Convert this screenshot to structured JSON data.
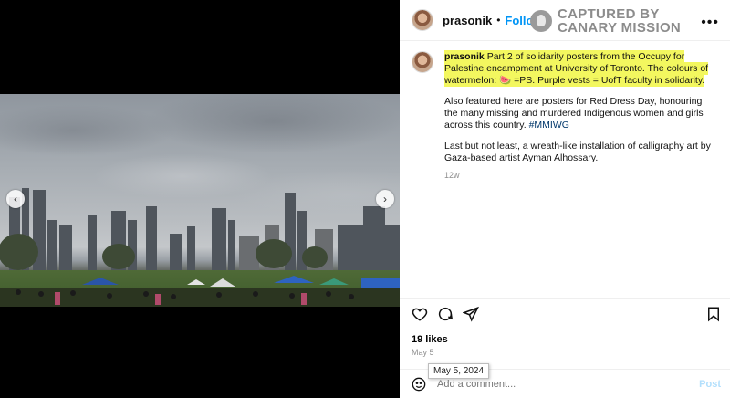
{
  "post": {
    "username": "prasonik",
    "separator": "•",
    "follow_label": "Follow",
    "more_label": "•••"
  },
  "watermark": {
    "line1": "CAPTURED BY",
    "line2": "CANARY MISSION"
  },
  "caption": {
    "username": "prasonik",
    "highlighted_text": "Part 2 of solidarity posters from the Occupy for Palestine encampment at University of Toronto. The colours of watermelon: 🍉 =PS. Purple vests = UofT faculty in solidarity.",
    "paragraph2_text": "Also featured here are posters for Red Dress Day, honouring the many missing and murdered Indigenous women and girls across this country. ",
    "paragraph2_hashtag": "#MMIWG",
    "paragraph3": "Last but not least, a wreath-like installation of calligraphy art by Gaza-based artist Ayman Alhossary.",
    "time_ago": "12w"
  },
  "engagement": {
    "likes": "19 likes",
    "date": "May 5",
    "tooltip_date": "May 5, 2024"
  },
  "comment": {
    "placeholder": "Add a comment...",
    "post_label": "Post"
  },
  "carousel": {
    "prev_label": "‹",
    "next_label": "›"
  },
  "colors": {
    "follow": "#0095f6",
    "highlight": "#f3f75f",
    "hashtag": "#00376b"
  }
}
